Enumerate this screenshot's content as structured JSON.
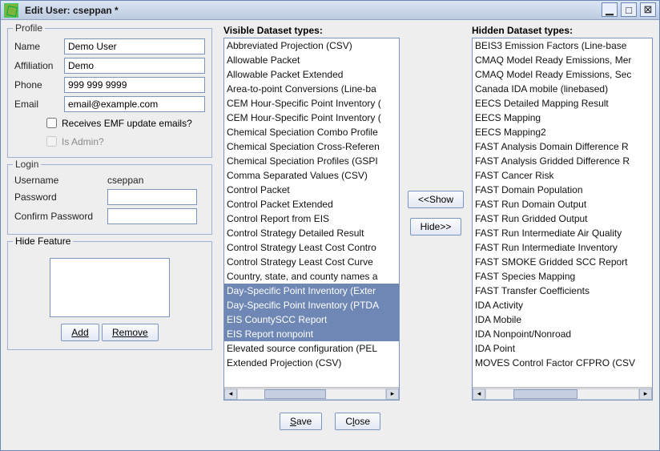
{
  "window": {
    "title": "Edit User: cseppan *"
  },
  "profile": {
    "legend": "Profile",
    "labels": {
      "name": "Name",
      "affiliation": "Affiliation",
      "phone": "Phone",
      "email": "Email"
    },
    "values": {
      "name": "Demo User",
      "affiliation": "Demo",
      "phone": "999 999 9999",
      "email": "email@example.com"
    },
    "receives_emf_label": "Receives EMF update emails?",
    "is_admin_label": "Is Admin?"
  },
  "login": {
    "legend": "Login",
    "labels": {
      "username": "Username",
      "password": "Password",
      "confirm": "Confirm Password"
    },
    "username_value": "cseppan"
  },
  "hide_feature": {
    "legend": "Hide Feature",
    "add_label": "Add",
    "remove_label": "Remove"
  },
  "lists": {
    "visible_header": "Visible Dataset types:",
    "hidden_header": "Hidden Dataset types:",
    "show_btn": "<<Show",
    "hide_btn": "Hide>>"
  },
  "visible_types": [
    {
      "t": "Abbreviated Projection (CSV)",
      "sel": false
    },
    {
      "t": "Allowable Packet",
      "sel": false
    },
    {
      "t": "Allowable Packet Extended",
      "sel": false
    },
    {
      "t": "Area-to-point Conversions (Line-ba",
      "sel": false
    },
    {
      "t": "CEM Hour-Specific Point Inventory (",
      "sel": false
    },
    {
      "t": "CEM Hour-Specific Point Inventory (",
      "sel": false
    },
    {
      "t": "Chemical Speciation Combo Profile",
      "sel": false
    },
    {
      "t": "Chemical Speciation Cross-Referen",
      "sel": false
    },
    {
      "t": "Chemical Speciation Profiles (GSPI",
      "sel": false
    },
    {
      "t": "Comma Separated Values (CSV)",
      "sel": false
    },
    {
      "t": "Control Packet",
      "sel": false
    },
    {
      "t": "Control Packet Extended",
      "sel": false
    },
    {
      "t": "Control Report from EIS",
      "sel": false
    },
    {
      "t": "Control Strategy Detailed Result",
      "sel": false
    },
    {
      "t": "Control Strategy Least Cost Contro",
      "sel": false
    },
    {
      "t": "Control Strategy Least Cost Curve",
      "sel": false
    },
    {
      "t": "Country, state, and county names a",
      "sel": false
    },
    {
      "t": "Day-Specific Point Inventory (Exter",
      "sel": true
    },
    {
      "t": "Day-Specific Point Inventory (PTDA",
      "sel": true
    },
    {
      "t": "EIS CountySCC Report",
      "sel": true
    },
    {
      "t": "EIS Report nonpoint",
      "sel": true
    },
    {
      "t": "Elevated source configuration (PEL",
      "sel": false
    },
    {
      "t": "Extended Projection (CSV)",
      "sel": false
    }
  ],
  "hidden_types": [
    "BEIS3 Emission Factors (Line-base",
    "CMAQ Model Ready Emissions, Mer",
    "CMAQ Model Ready Emissions, Sec",
    "Canada IDA mobile (linebased)",
    "EECS Detailed Mapping Result",
    "EECS Mapping",
    "EECS Mapping2",
    "FAST Analysis Domain Difference R",
    "FAST Analysis Gridded Difference R",
    "FAST Cancer Risk",
    "FAST Domain Population",
    "FAST Run Domain Output",
    "FAST Run Gridded Output",
    "FAST Run Intermediate Air Quality",
    "FAST Run Intermediate Inventory",
    "FAST SMOKE Gridded SCC Report",
    "FAST Species Mapping",
    "FAST Transfer Coefficients",
    "IDA Activity",
    "IDA Mobile",
    "IDA Nonpoint/Nonroad",
    "IDA Point",
    "MOVES Control Factor CFPRO (CSV"
  ],
  "footer": {
    "save": "Save",
    "save_mn": "S",
    "close": "Close",
    "close_mn": "l"
  }
}
